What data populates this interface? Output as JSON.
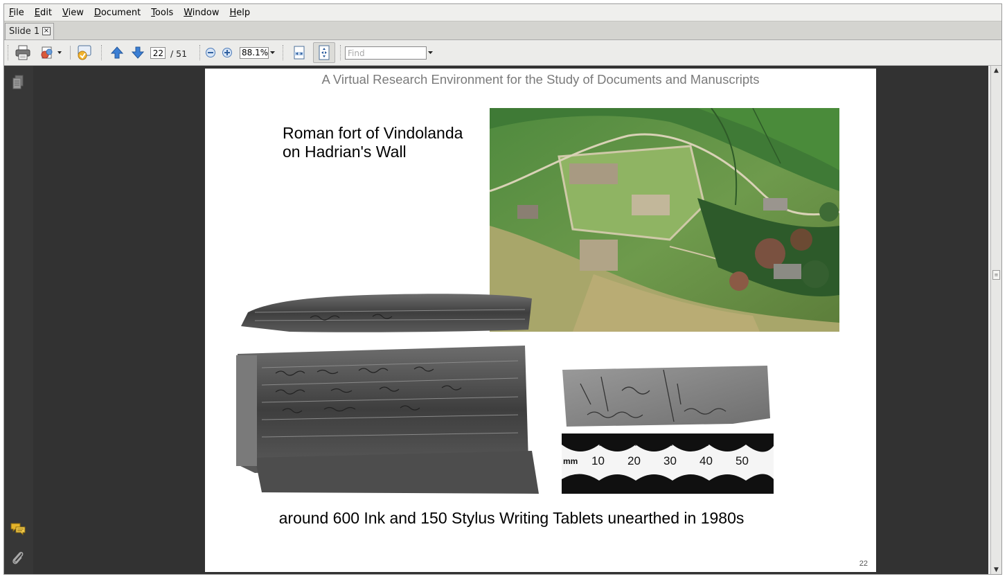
{
  "menu": [
    {
      "key": "F",
      "rest": "ile"
    },
    {
      "key": "E",
      "rest": "dit"
    },
    {
      "key": "V",
      "rest": "iew"
    },
    {
      "key": "D",
      "rest": "ocument"
    },
    {
      "key": "T",
      "rest": "ools"
    },
    {
      "key": "W",
      "rest": "indow"
    },
    {
      "key": "H",
      "rest": "elp"
    }
  ],
  "tab": {
    "label": "Slide 1",
    "close": "×"
  },
  "toolbar": {
    "page_current": "22",
    "page_total": "/ 51",
    "zoom": "88.1%",
    "find_placeholder": "Find"
  },
  "slide": {
    "header": "A Virtual Research Environment for the Study of Documents and Manuscripts",
    "caption_line1": "Roman fort of Vindolanda",
    "caption_line2": "on Hadrian's Wall",
    "footer": "around 600 Ink and 150 Stylus Writing Tablets unearthed in 1980s",
    "number": "22",
    "ruler_unit": "mm",
    "ruler_ticks": [
      "10",
      "20",
      "30",
      "40",
      "50"
    ]
  },
  "colors": {
    "viewer_bg": "#323232",
    "sidebar_bg": "#373737",
    "accent_blue": "#3b7fd4"
  }
}
